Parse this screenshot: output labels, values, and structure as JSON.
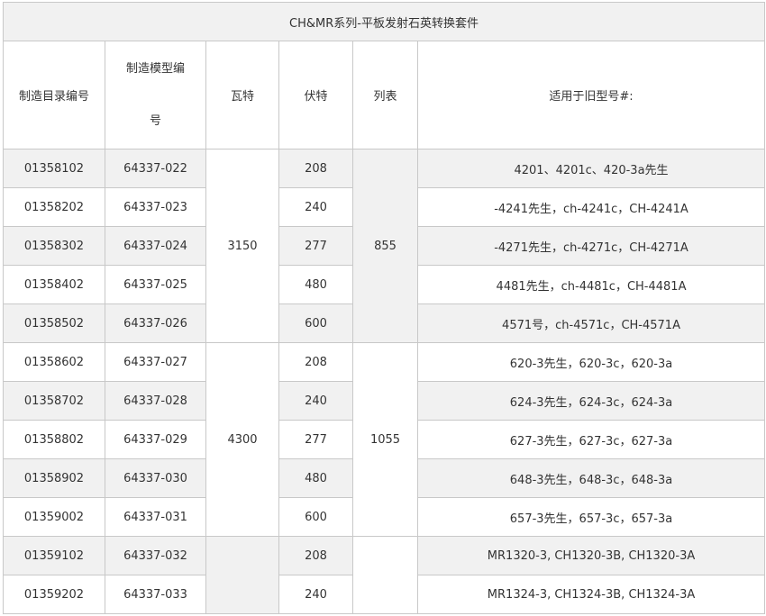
{
  "table": {
    "title": "CH&MR系列-平板发射石英转换套件",
    "headers": {
      "catalog": "制造目录编号",
      "model_line1": "制造模型编",
      "model_line2": "号",
      "watts": "瓦特",
      "volts": "伏特",
      "list": "列表",
      "replaces": "适用于旧型号#:"
    },
    "groups": [
      {
        "watts": "3150",
        "list": "855"
      },
      {
        "watts": "4300",
        "list": "1055"
      },
      {
        "watts": "",
        "list": ""
      }
    ],
    "rows": [
      {
        "catalog": "01358102",
        "model": "64337-022",
        "volts": "208",
        "replaces": "4201、4201c、420-3a先生"
      },
      {
        "catalog": "01358202",
        "model": "64337-023",
        "volts": "240",
        "replaces": "-4241先生，ch-4241c，CH-4241A"
      },
      {
        "catalog": "01358302",
        "model": "64337-024",
        "volts": "277",
        "replaces": "-4271先生，ch-4271c，CH-4271A"
      },
      {
        "catalog": "01358402",
        "model": "64337-025",
        "volts": "480",
        "replaces": "4481先生，ch-4481c，CH-4481A"
      },
      {
        "catalog": "01358502",
        "model": "64337-026",
        "volts": "600",
        "replaces": "4571号，ch-4571c，CH-4571A"
      },
      {
        "catalog": "01358602",
        "model": "64337-027",
        "volts": "208",
        "replaces": "620-3先生，620-3c，620-3a"
      },
      {
        "catalog": "01358702",
        "model": "64337-028",
        "volts": "240",
        "replaces": "624-3先生，624-3c，624-3a"
      },
      {
        "catalog": "01358802",
        "model": "64337-029",
        "volts": "277",
        "replaces": "627-3先生，627-3c，627-3a"
      },
      {
        "catalog": "01358902",
        "model": "64337-030",
        "volts": "480",
        "replaces": "648-3先生，648-3c，648-3a"
      },
      {
        "catalog": "01359002",
        "model": "64337-031",
        "volts": "600",
        "replaces": "657-3先生，657-3c，657-3a"
      },
      {
        "catalog": "01359102",
        "model": "64337-032",
        "volts": "208",
        "replaces": "MR1320-3, CH1320-3B, CH1320-3A"
      },
      {
        "catalog": "01359202",
        "model": "64337-033",
        "volts": "240",
        "replaces": "MR1324-3, CH1324-3B, CH1324-3A"
      }
    ]
  }
}
